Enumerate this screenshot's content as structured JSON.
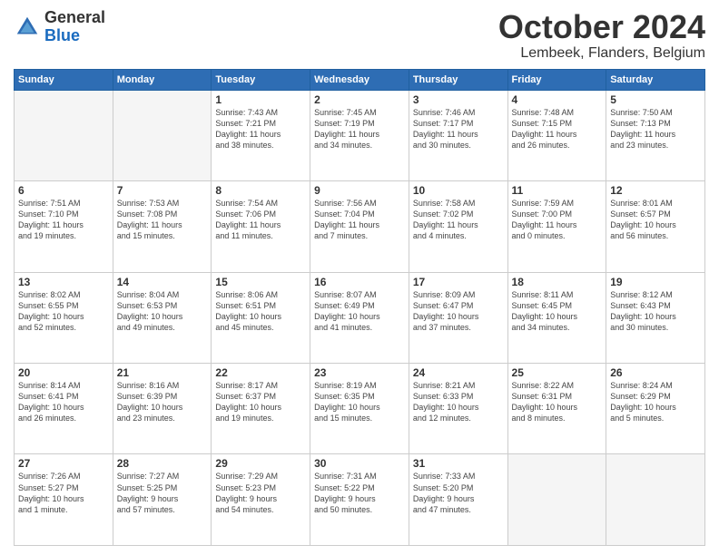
{
  "header": {
    "logo": {
      "general": "General",
      "blue": "Blue"
    },
    "title": "October 2024",
    "location": "Lembeek, Flanders, Belgium"
  },
  "weekdays": [
    "Sunday",
    "Monday",
    "Tuesday",
    "Wednesday",
    "Thursday",
    "Friday",
    "Saturday"
  ],
  "weeks": [
    [
      {
        "day": null,
        "info": null
      },
      {
        "day": null,
        "info": null
      },
      {
        "day": "1",
        "info": "Sunrise: 7:43 AM\nSunset: 7:21 PM\nDaylight: 11 hours\nand 38 minutes."
      },
      {
        "day": "2",
        "info": "Sunrise: 7:45 AM\nSunset: 7:19 PM\nDaylight: 11 hours\nand 34 minutes."
      },
      {
        "day": "3",
        "info": "Sunrise: 7:46 AM\nSunset: 7:17 PM\nDaylight: 11 hours\nand 30 minutes."
      },
      {
        "day": "4",
        "info": "Sunrise: 7:48 AM\nSunset: 7:15 PM\nDaylight: 11 hours\nand 26 minutes."
      },
      {
        "day": "5",
        "info": "Sunrise: 7:50 AM\nSunset: 7:13 PM\nDaylight: 11 hours\nand 23 minutes."
      }
    ],
    [
      {
        "day": "6",
        "info": "Sunrise: 7:51 AM\nSunset: 7:10 PM\nDaylight: 11 hours\nand 19 minutes."
      },
      {
        "day": "7",
        "info": "Sunrise: 7:53 AM\nSunset: 7:08 PM\nDaylight: 11 hours\nand 15 minutes."
      },
      {
        "day": "8",
        "info": "Sunrise: 7:54 AM\nSunset: 7:06 PM\nDaylight: 11 hours\nand 11 minutes."
      },
      {
        "day": "9",
        "info": "Sunrise: 7:56 AM\nSunset: 7:04 PM\nDaylight: 11 hours\nand 7 minutes."
      },
      {
        "day": "10",
        "info": "Sunrise: 7:58 AM\nSunset: 7:02 PM\nDaylight: 11 hours\nand 4 minutes."
      },
      {
        "day": "11",
        "info": "Sunrise: 7:59 AM\nSunset: 7:00 PM\nDaylight: 11 hours\nand 0 minutes."
      },
      {
        "day": "12",
        "info": "Sunrise: 8:01 AM\nSunset: 6:57 PM\nDaylight: 10 hours\nand 56 minutes."
      }
    ],
    [
      {
        "day": "13",
        "info": "Sunrise: 8:02 AM\nSunset: 6:55 PM\nDaylight: 10 hours\nand 52 minutes."
      },
      {
        "day": "14",
        "info": "Sunrise: 8:04 AM\nSunset: 6:53 PM\nDaylight: 10 hours\nand 49 minutes."
      },
      {
        "day": "15",
        "info": "Sunrise: 8:06 AM\nSunset: 6:51 PM\nDaylight: 10 hours\nand 45 minutes."
      },
      {
        "day": "16",
        "info": "Sunrise: 8:07 AM\nSunset: 6:49 PM\nDaylight: 10 hours\nand 41 minutes."
      },
      {
        "day": "17",
        "info": "Sunrise: 8:09 AM\nSunset: 6:47 PM\nDaylight: 10 hours\nand 37 minutes."
      },
      {
        "day": "18",
        "info": "Sunrise: 8:11 AM\nSunset: 6:45 PM\nDaylight: 10 hours\nand 34 minutes."
      },
      {
        "day": "19",
        "info": "Sunrise: 8:12 AM\nSunset: 6:43 PM\nDaylight: 10 hours\nand 30 minutes."
      }
    ],
    [
      {
        "day": "20",
        "info": "Sunrise: 8:14 AM\nSunset: 6:41 PM\nDaylight: 10 hours\nand 26 minutes."
      },
      {
        "day": "21",
        "info": "Sunrise: 8:16 AM\nSunset: 6:39 PM\nDaylight: 10 hours\nand 23 minutes."
      },
      {
        "day": "22",
        "info": "Sunrise: 8:17 AM\nSunset: 6:37 PM\nDaylight: 10 hours\nand 19 minutes."
      },
      {
        "day": "23",
        "info": "Sunrise: 8:19 AM\nSunset: 6:35 PM\nDaylight: 10 hours\nand 15 minutes."
      },
      {
        "day": "24",
        "info": "Sunrise: 8:21 AM\nSunset: 6:33 PM\nDaylight: 10 hours\nand 12 minutes."
      },
      {
        "day": "25",
        "info": "Sunrise: 8:22 AM\nSunset: 6:31 PM\nDaylight: 10 hours\nand 8 minutes."
      },
      {
        "day": "26",
        "info": "Sunrise: 8:24 AM\nSunset: 6:29 PM\nDaylight: 10 hours\nand 5 minutes."
      }
    ],
    [
      {
        "day": "27",
        "info": "Sunrise: 7:26 AM\nSunset: 5:27 PM\nDaylight: 10 hours\nand 1 minute."
      },
      {
        "day": "28",
        "info": "Sunrise: 7:27 AM\nSunset: 5:25 PM\nDaylight: 9 hours\nand 57 minutes."
      },
      {
        "day": "29",
        "info": "Sunrise: 7:29 AM\nSunset: 5:23 PM\nDaylight: 9 hours\nand 54 minutes."
      },
      {
        "day": "30",
        "info": "Sunrise: 7:31 AM\nSunset: 5:22 PM\nDaylight: 9 hours\nand 50 minutes."
      },
      {
        "day": "31",
        "info": "Sunrise: 7:33 AM\nSunset: 5:20 PM\nDaylight: 9 hours\nand 47 minutes."
      },
      {
        "day": null,
        "info": null
      },
      {
        "day": null,
        "info": null
      }
    ]
  ]
}
